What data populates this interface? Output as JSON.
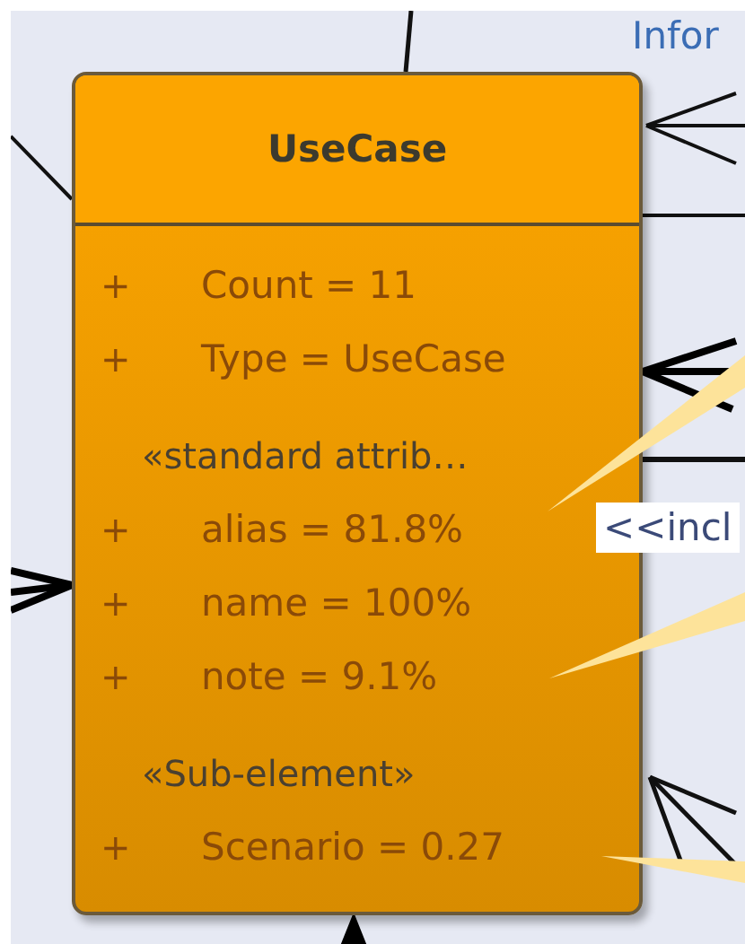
{
  "canvas_labels": [
    {
      "kind": "plain",
      "text": "Infor"
    },
    {
      "kind": "boxed",
      "text": "<<incl"
    }
  ],
  "node": {
    "name": "UseCase",
    "compartments": [
      {
        "attributes": [
          {
            "visibility": "+",
            "text": "Count = 11"
          },
          {
            "visibility": "+",
            "text": "Type = UseCase"
          }
        ]
      },
      {
        "stereotype": "«standard attrib…",
        "attributes": [
          {
            "visibility": "+",
            "text": "alias = 81.8%"
          },
          {
            "visibility": "+",
            "text": "name = 100%"
          },
          {
            "visibility": "+",
            "text": "note = 9.1%"
          }
        ]
      },
      {
        "stereotype": "«Sub-element»",
        "attributes": [
          {
            "visibility": "+",
            "text": "Scenario = 0.27"
          }
        ]
      }
    ]
  }
}
